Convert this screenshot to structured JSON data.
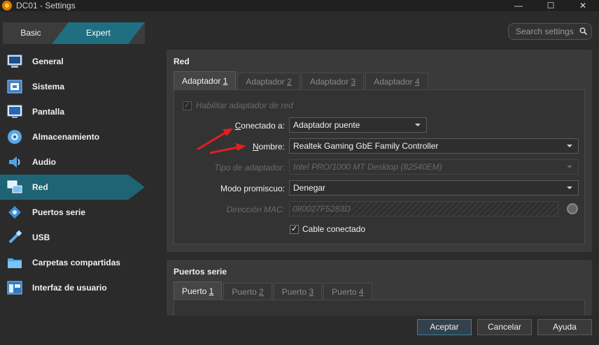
{
  "window": {
    "title": "DC01 - Settings",
    "min": "—",
    "max": "☐",
    "close": "✕"
  },
  "modes": {
    "basic": "Basic",
    "expert": "Expert"
  },
  "search": {
    "placeholder": "Search settings"
  },
  "sidebar": {
    "items": [
      {
        "label": "General",
        "icon": "monitor-icon"
      },
      {
        "label": "Sistema",
        "icon": "chip-icon"
      },
      {
        "label": "Pantalla",
        "icon": "display-icon"
      },
      {
        "label": "Almacenamiento",
        "icon": "storage-icon"
      },
      {
        "label": "Audio",
        "icon": "speaker-icon"
      },
      {
        "label": "Red",
        "icon": "network-icon"
      },
      {
        "label": "Puertos serie",
        "icon": "serial-port-icon"
      },
      {
        "label": "USB",
        "icon": "usb-icon"
      },
      {
        "label": "Carpetas compartidas",
        "icon": "folder-icon"
      },
      {
        "label": "Interfaz de usuario",
        "icon": "ui-icon"
      }
    ],
    "active": "Red"
  },
  "red": {
    "title": "Red",
    "tabs": [
      {
        "pre": "Adaptador ",
        "num": "1"
      },
      {
        "pre": "Adaptador ",
        "num": "2"
      },
      {
        "pre": "Adaptador ",
        "num": "3"
      },
      {
        "pre": "Adaptador ",
        "num": "4"
      }
    ],
    "enable_label": "Habilitar adaptador de red",
    "attached_label_pre": "",
    "attached_label_u": "C",
    "attached_label_post": "onectado a:",
    "attached_value": "Adaptador puente",
    "name_label_u": "N",
    "name_label_post": "ombre:",
    "name_value": "Realtek Gaming GbE Family Controller",
    "adapter_type_label": "Tipo de adaptador:",
    "adapter_type_value": "Intel PRO/1000 MT Desktop (82540EM)",
    "promisc_label": "Modo promiscuo:",
    "promisc_value": "Denegar",
    "mac_label": "Dirección MAC:",
    "mac_value": "080027F5283D",
    "cable_label": "Cable conectado",
    "check_mark": "✓"
  },
  "serie": {
    "title": "Puertos serie",
    "tabs": [
      {
        "pre": "Puerto ",
        "num": "1"
      },
      {
        "pre": "Puerto ",
        "num": "2"
      },
      {
        "pre": "Puerto ",
        "num": "3"
      },
      {
        "pre": "Puerto ",
        "num": "4"
      }
    ]
  },
  "buttons": {
    "accept": "Aceptar",
    "cancel": "Cancelar",
    "help": "Ayuda"
  },
  "colors": {
    "accent": "#1f6f81",
    "annotation_arrow": "#e02020"
  }
}
